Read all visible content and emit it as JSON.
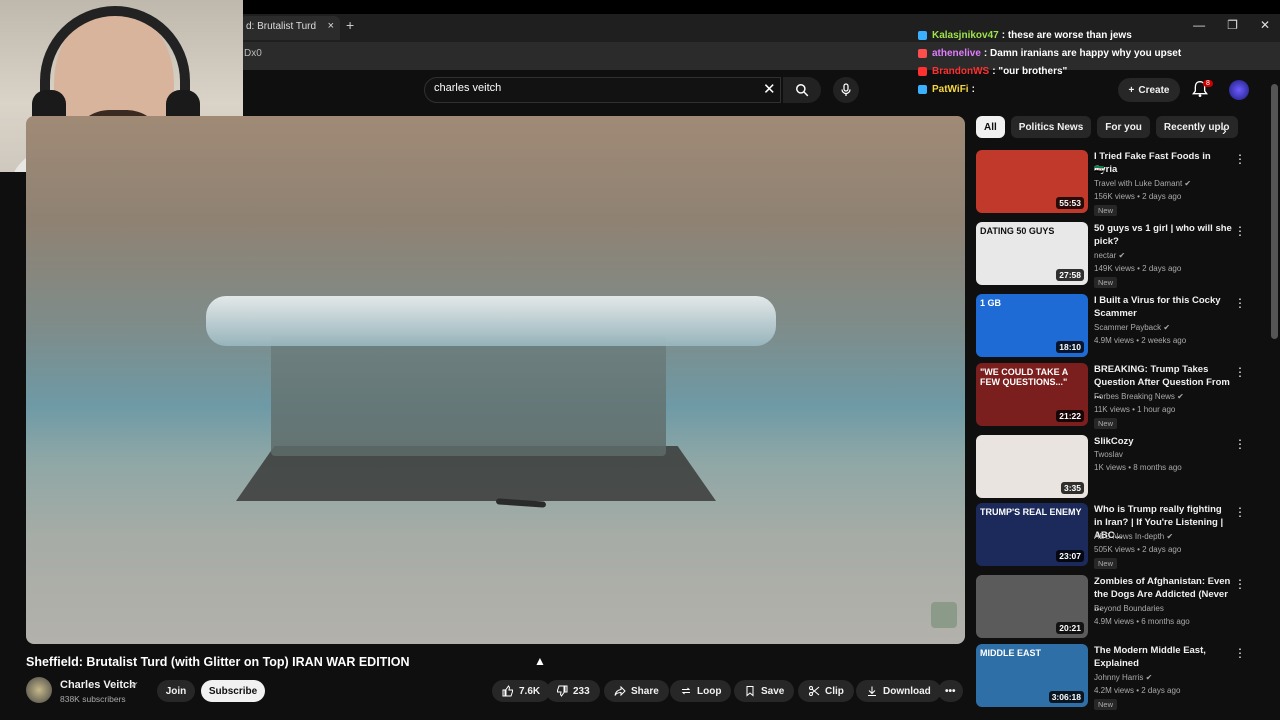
{
  "browser": {
    "tab_title": "d: Brutalist Turd",
    "tab_close": "×",
    "new_tab": "+",
    "url_fragment": "Dx0",
    "window_minimize": "—",
    "window_maximize": "❐",
    "window_close": "✕"
  },
  "chat": [
    {
      "user": "Kalasjnikov47",
      "message": ": these are worse than jews",
      "color": "#9fe34a",
      "badge": "#3ab0ff"
    },
    {
      "user": "athenelive",
      "message": ": Damn iranians are happy why you upset",
      "color": "#e07cff",
      "badge": "#ff4d4d"
    },
    {
      "user": "BrandonWS",
      "message": ": \"our brothers\"",
      "color": "#ff3030",
      "badge": "#ff3030"
    },
    {
      "user": "PatWiFi",
      "message": ":",
      "color": "#f5d742",
      "badge": "#3ab0ff"
    }
  ],
  "header": {
    "search_value": "charles veitch",
    "search_clear": "✕",
    "create_label": "Create",
    "notification_count": "8"
  },
  "video": {
    "title": "Sheffield: Brutalist Turd (with Glitter on Top) IRAN WAR EDITION",
    "channel_name": "Charles Veitch",
    "channel_subs": "838K subscribers",
    "join_label": "Join",
    "subscribe_label": "Subscribe",
    "likes": "7.6K",
    "dislikes": "233",
    "share_label": "Share",
    "loop_label": "Loop",
    "save_label": "Save",
    "clip_label": "Clip",
    "download_label": "Download",
    "more_label": "•••"
  },
  "chips": [
    "All",
    "Politics News",
    "For you",
    "Recently uplo"
  ],
  "chip_next": "›",
  "recommendations": [
    {
      "title": "I Tried Fake Fast Foods in Syria",
      "title2": "🇸🇾",
      "channel": "Travel with Luke Damant",
      "verified": true,
      "meta": "156K views • 2 days ago",
      "new": "New",
      "duration": "55:53",
      "thumb_color": "#c0392b"
    },
    {
      "title": "50 guys vs 1 girl | who will she pick?",
      "channel": "nectar",
      "verified": true,
      "meta": "149K views • 2 days ago",
      "new": "New",
      "duration": "27:58",
      "thumb_color": "#e8e8e8",
      "thumb_text": "DATING 50 GUYS"
    },
    {
      "title": "I Built a Virus for this Cocky Scammer",
      "channel": "Scammer Payback",
      "verified": true,
      "meta": "4.9M views • 2 weeks ago",
      "new": "",
      "duration": "18:10",
      "thumb_color": "#1e6bd6",
      "thumb_text": "1 GB"
    },
    {
      "title": "BREAKING: Trump Takes Question After Question From ...",
      "channel": "Forbes Breaking News",
      "verified": true,
      "meta": "11K views • 1 hour ago",
      "new": "New",
      "duration": "21:22",
      "thumb_color": "#7a1e1e",
      "thumb_text": "\"WE COULD TAKE A FEW QUESTIONS...\""
    },
    {
      "title": "SlikCozy",
      "channel": "Twoslav",
      "verified": false,
      "meta": "1K views • 8 months ago",
      "new": "",
      "duration": "3:35",
      "thumb_color": "#e9e4e0"
    },
    {
      "title": "Who is Trump really fighting in Iran? | If You're Listening | ABC...",
      "channel": "ABC News In-depth",
      "verified": true,
      "meta": "505K views • 2 days ago",
      "new": "New",
      "duration": "23:07",
      "thumb_color": "#1b2a5a",
      "thumb_text": "TRUMP'S REAL ENEMY"
    },
    {
      "title": "Zombies of Afghanistan: Even the Dogs Are Addicted (Never ...",
      "channel": "Beyond Boundaries",
      "verified": false,
      "meta": "4.9M views • 6 months ago",
      "new": "",
      "duration": "20:21",
      "thumb_color": "#5b5b5b"
    },
    {
      "title": "The Modern Middle East, Explained",
      "channel": "Johnny Harris",
      "verified": true,
      "meta": "4.2M views • 2 days ago",
      "new": "New",
      "duration": "3:06:18",
      "thumb_color": "#2e6fa8",
      "thumb_text": "MIDDLE EAST"
    }
  ],
  "rec_menu": "⋮"
}
